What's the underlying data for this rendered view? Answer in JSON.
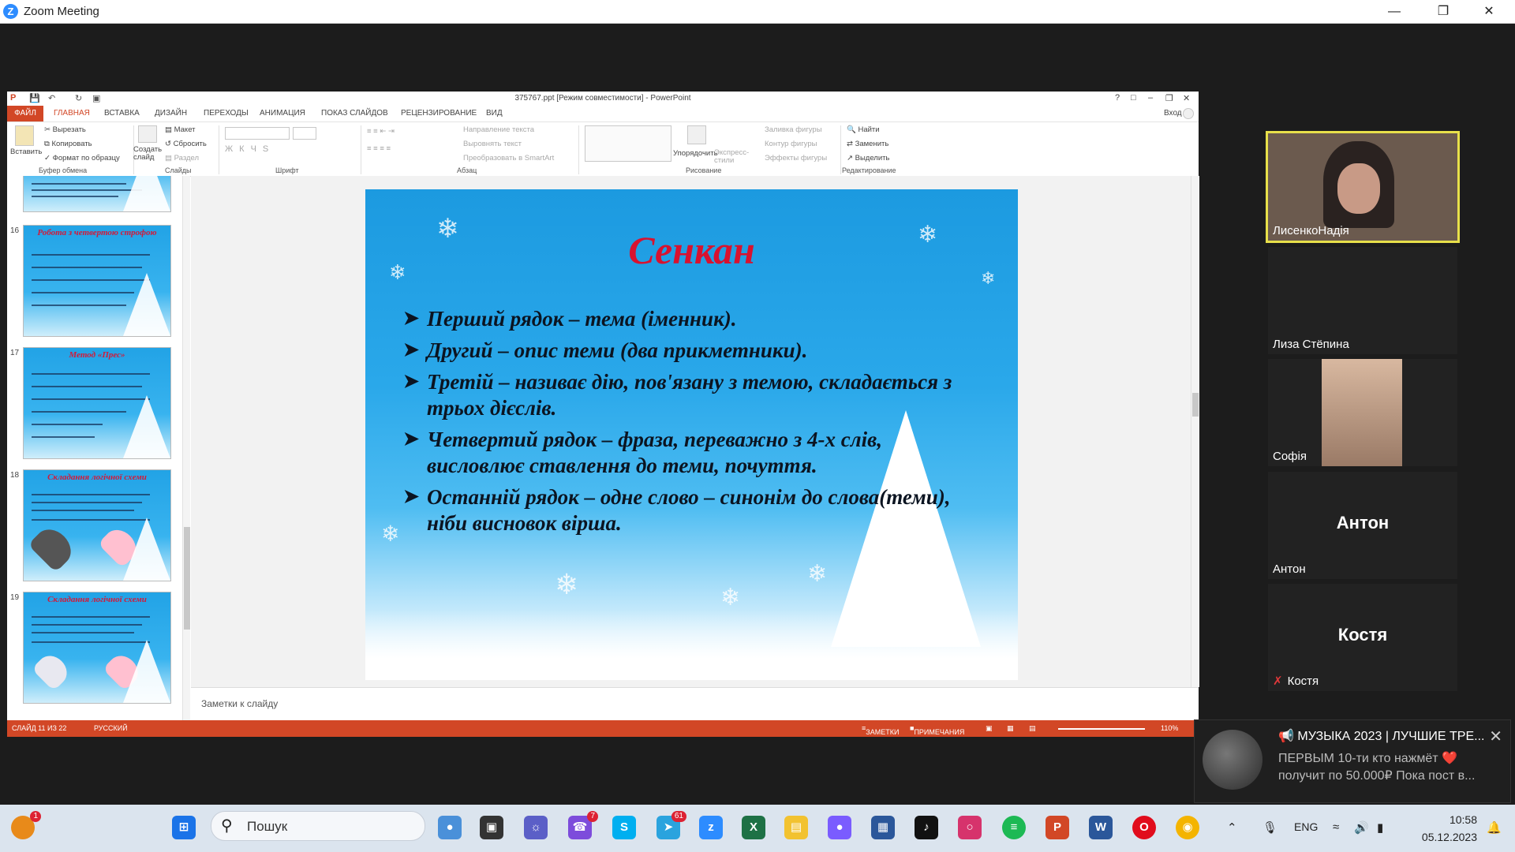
{
  "zoom": {
    "title": "Zoom Meeting",
    "logo": "Z"
  },
  "ppt": {
    "title": "375767.ppt [Режим совместимости] - PowerPoint",
    "sign_in": "Вход",
    "help": "?",
    "tabs": [
      "ФАЙЛ",
      "ГЛАВНАЯ",
      "ВСТАВКА",
      "ДИЗАЙН",
      "ПЕРЕХОДЫ",
      "АНИМАЦИЯ",
      "ПОКАЗ СЛАЙДОВ",
      "РЕЦЕНЗИРОВАНИЕ",
      "ВИД"
    ],
    "ribbon": {
      "paste": "Вставить",
      "cut": "Вырезать",
      "copy": "Копировать",
      "format_painter": "Формат по образцу",
      "clipboard": "Буфер обмена",
      "new_slide": "Создать слайд",
      "layout": "Макет",
      "reset": "Сбросить",
      "section": "Раздел",
      "slides": "Слайды",
      "font": "Шрифт",
      "text_direction": "Направление текста",
      "align_text": "Выровнять текст",
      "smartart": "Преобразовать в SmartArt",
      "paragraph": "Абзац",
      "arrange": "Упорядочить",
      "quick_styles": "Экспресс-стили",
      "shape_fill": "Заливка фигуры",
      "shape_outline": "Контур фигуры",
      "shape_effects": "Эффекты фигуры",
      "drawing": "Рисование",
      "find": "Найти",
      "replace": "Заменить",
      "select": "Выделить",
      "editing": "Редактирование"
    },
    "thumbnails": [
      {
        "num": "16",
        "title": "Робота з четвертою строфою"
      },
      {
        "num": "17",
        "title": "Метод «Прес»"
      },
      {
        "num": "18",
        "title": "Складання логічної схеми"
      },
      {
        "num": "19",
        "title": "Складання логічної схеми"
      }
    ],
    "slide": {
      "title": "Сенкан",
      "bullets": [
        "Перший рядок – тема (іменник).",
        "Другий – опис теми (два прикметники).",
        "Третій – називає дію, пов'язану з темою, складається з трьох дієслів.",
        "Четвертий рядок – фраза, переважно з 4-х слів, висловлює ставлення до теми, почуття.",
        "Останній рядок – одне слово – синонім до слова(теми), ніби висновок вірша."
      ]
    },
    "notes_placeholder": "Заметки к слайду",
    "status": {
      "slide": "СЛАЙД 11 ИЗ 22",
      "language": "РУССКИЙ",
      "notes": "ЗАМЕТКИ",
      "comments": "ПРИМЕЧАНИЯ",
      "zoom": "110%"
    }
  },
  "participants": [
    {
      "name": "ЛисенкоНадія",
      "video": true,
      "active": true
    },
    {
      "name": "Лиза Стёпина",
      "video": false
    },
    {
      "name": "Софія",
      "video": true
    },
    {
      "name": "Антон",
      "display": "Антон",
      "video": false
    },
    {
      "name": "Костя",
      "display": "Костя",
      "video": false,
      "muted": true
    }
  ],
  "notification": {
    "title": "📢 МУЗЫКА 2023 | ЛУЧШИЕ ТРЕ...",
    "line1": "ПЕРВЫМ 10-ти кто нажмёт ❤️",
    "line2": "получит по 50.000₽ Пока пост в..."
  },
  "taskbar": {
    "search": "Пошук",
    "language": "ENG",
    "time": "10:58",
    "date": "05.12.2023",
    "badges": {
      "viber": "7",
      "telegram": "61",
      "left": "1"
    }
  }
}
